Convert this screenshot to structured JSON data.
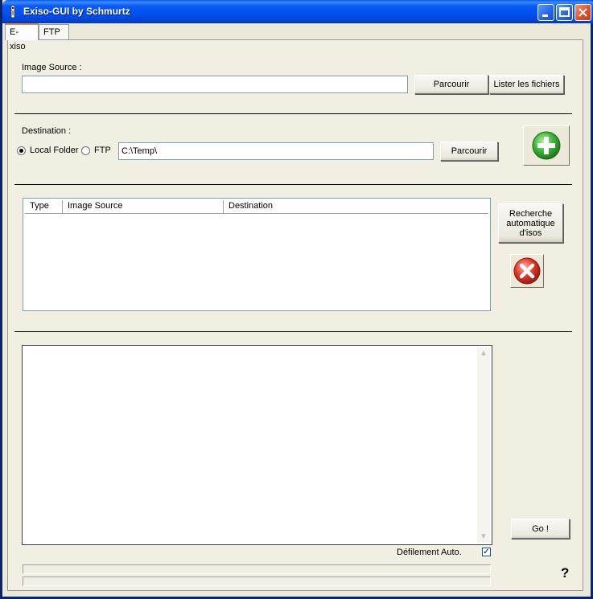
{
  "window": {
    "title": "Exiso-GUI by Schmurtz"
  },
  "tabs": [
    {
      "label": "E-xiso"
    },
    {
      "label": "FTP"
    }
  ],
  "source": {
    "label": "Image Source :",
    "value": "",
    "browse_label": "Parcourir",
    "list_label": "Lister les fichiers"
  },
  "destination": {
    "label": "Destination :",
    "local_label": "Local Folder",
    "ftp_label": "FTP",
    "selected": "Local Folder",
    "value": "C:\\Temp\\",
    "browse_label": "Parcourir",
    "add_icon": "plus-icon"
  },
  "queue": {
    "columns": [
      "Type",
      "Image Source",
      "Destination"
    ],
    "rows": [],
    "auto_search_line1": "Recherche",
    "auto_search_line2": "automatique",
    "auto_search_line3": "d'isos",
    "remove_icon": "x-icon"
  },
  "log": {
    "text": "",
    "go_label": "Go !",
    "autoscroll_label": "Défilement Auto.",
    "autoscroll_checked": true,
    "check_mark": "✓"
  },
  "help": {
    "label": "?"
  },
  "colors": {
    "titlebar": "#0a5cf5",
    "add": "#3aa53a",
    "remove": "#d0281e"
  }
}
